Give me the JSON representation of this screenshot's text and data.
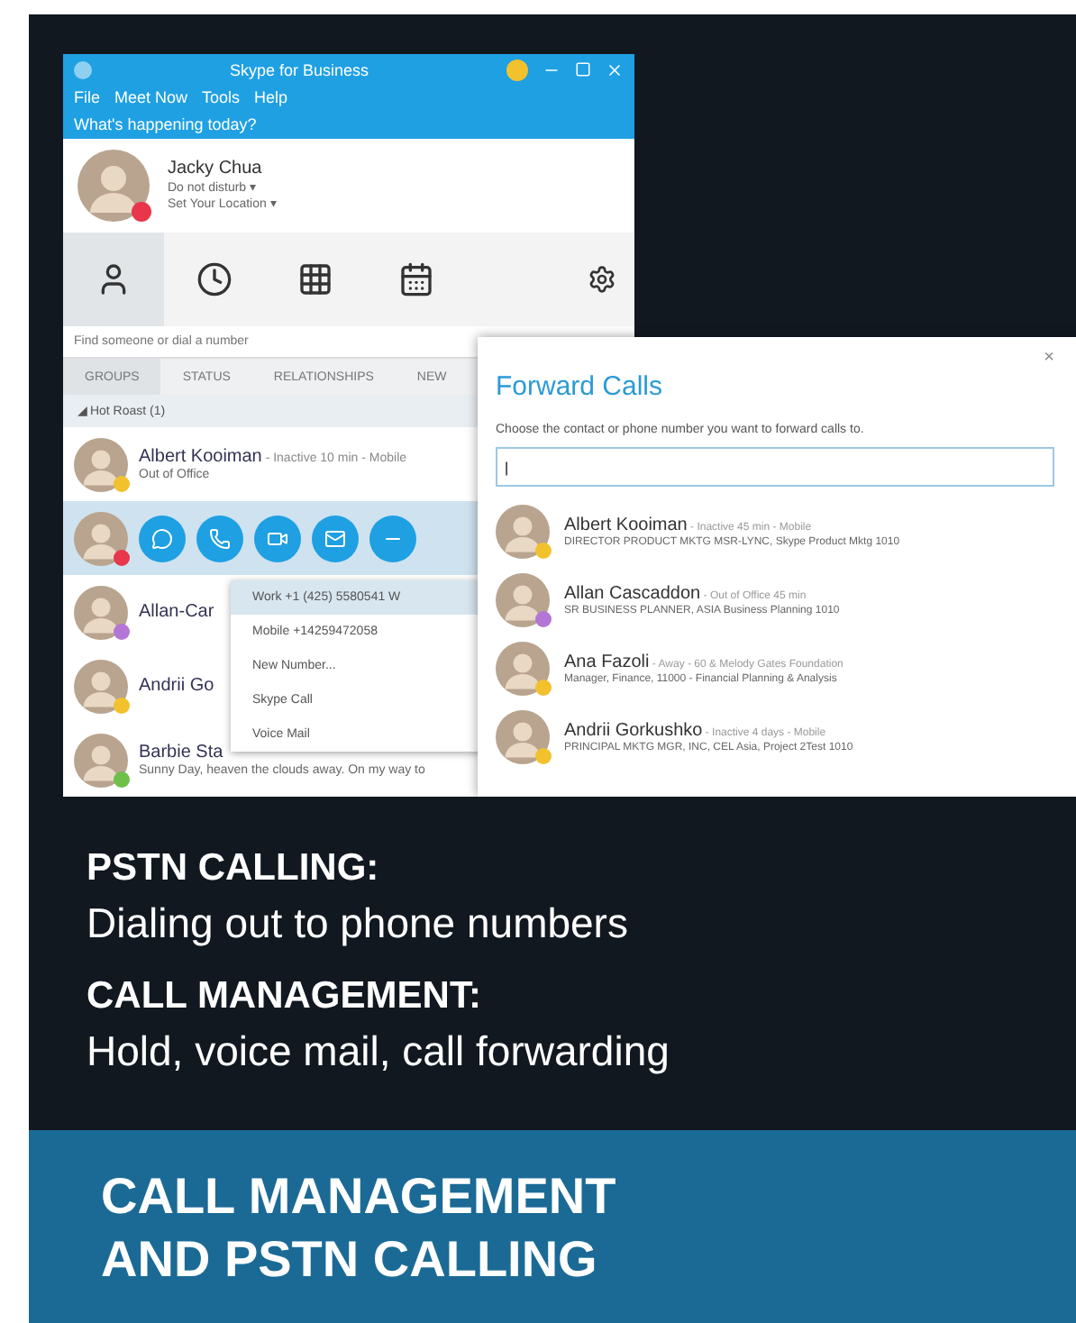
{
  "app_window": {
    "title": "Skype for Business",
    "menu": [
      "File",
      "Meet Now",
      "Tools",
      "Help"
    ],
    "mood": "What's happening today?",
    "profile": {
      "name": "Jacky Chua",
      "status": "Do not disturb ▾",
      "location": "Set Your Location ▾",
      "color": "#e8364a"
    },
    "nav_tabs": [
      {
        "kind": "contacts",
        "selected": true
      },
      {
        "kind": "history",
        "selected": false
      },
      {
        "kind": "dialpad",
        "selected": false
      },
      {
        "kind": "meetings",
        "selected": false
      }
    ],
    "search": {
      "placeholder": "Find someone or dial a number"
    },
    "list_tabs": [
      {
        "label": "GROUPS",
        "selected": true
      },
      {
        "label": "STATUS",
        "selected": false
      },
      {
        "label": "RELATIONSHIPS",
        "selected": false
      },
      {
        "label": "NEW",
        "selected": false
      }
    ],
    "group": "◢ Hot Roast (1)",
    "contacts": [
      {
        "name": "Albert Kooiman",
        "detail": " - Inactive 10 min - Mobile",
        "note": "Out of Office",
        "color": "#f2c12e",
        "selected": false
      },
      {
        "color": "#e8364a",
        "selected": true
      },
      {
        "name": "Allan-Car",
        "color": "#b476d6",
        "selected": false
      },
      {
        "name": "Andrii Go",
        "color": "#f2c12e",
        "selected": false
      },
      {
        "name": "Barbie Sta",
        "note": "Sunny Day, heaven the clouds away. On my way to",
        "color": "#6fc04b",
        "selected": false
      }
    ],
    "call_menu": [
      {
        "label": "Work +1 (425) 5580541 W",
        "selected": true
      },
      {
        "label": "Mobile +14259472058",
        "selected": false
      },
      {
        "label": "New Number...",
        "selected": false
      },
      {
        "label": "Skype Call",
        "selected": false
      },
      {
        "label": "Voice Mail",
        "selected": false
      }
    ]
  },
  "forward_dialog": {
    "title": "Forward Calls",
    "close": "×",
    "prompt": "Choose the contact or phone number you want to forward calls to.",
    "input": "|",
    "contacts": [
      {
        "name": "Albert Kooiman",
        "detail": " - Inactive 45 min - Mobile",
        "note": "DIRECTOR PRODUCT MKTG MSR-LYNC, Skype Product Mktg 1010",
        "color": "#f2c12e"
      },
      {
        "name": "Allan Cascaddon",
        "detail": " - Out of Office 45 min",
        "note": "SR BUSINESS PLANNER, ASIA Business Planning 1010",
        "color": "#b476d6"
      },
      {
        "name": "Ana Fazoli",
        "detail": " - Away - 60 & Melody Gates Foundation",
        "note": "Manager, Finance, 11000 - Financial Planning & Analysis",
        "color": "#f2c12e"
      },
      {
        "name": "Andrii Gorkushko",
        "detail": " - Inactive 4 days - Mobile",
        "note": "PRINCIPAL MKTG MGR, INC, CEL Asia, Project 2Test 1010",
        "color": "#f2c12e"
      }
    ]
  },
  "features": [
    {
      "heading": "PSTN CALLING:",
      "text": "Dialing out to phone numbers"
    },
    {
      "heading": "CALL MANAGEMENT:",
      "text": "Hold, voice mail, call forwarding"
    }
  ],
  "banner": [
    "CALL MANAGEMENT",
    "AND PSTN CALLING"
  ]
}
